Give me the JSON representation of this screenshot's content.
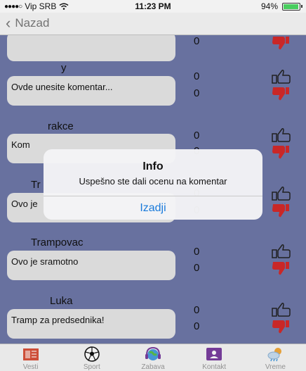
{
  "status": {
    "carrier": "Vip SRB",
    "time": "11:23 PM",
    "battery": "94%",
    "battery_level": 0.94
  },
  "nav": {
    "back_label": "Nazad"
  },
  "comments": [
    {
      "author": "",
      "text": "",
      "likes": "",
      "dislikes": "0"
    },
    {
      "author": "y",
      "text": "Ovde unesite komentar...",
      "likes": "0",
      "dislikes": "0"
    },
    {
      "author": "rakce",
      "text": "Kom",
      "likes": "0",
      "dislikes": "0"
    },
    {
      "author": "Tr",
      "text": "Ovo je",
      "likes": "0",
      "dislikes": "0"
    },
    {
      "author": "Trampovac",
      "text": "Ovo je sramotno",
      "likes": "0",
      "dislikes": "0"
    },
    {
      "author": "Luka",
      "text": "Tramp za predsednika!",
      "likes": "0",
      "dislikes": "0"
    }
  ],
  "alert": {
    "title": "Info",
    "message": "Uspešno ste dali ocenu na komentar",
    "button": "Izadji"
  },
  "tabs": [
    {
      "label": "Vesti",
      "icon": "newspaper-icon"
    },
    {
      "label": "Sport",
      "icon": "soccer-ball-icon"
    },
    {
      "label": "Zabava",
      "icon": "globe-headphones-icon"
    },
    {
      "label": "Kontakt",
      "icon": "contact-card-icon"
    },
    {
      "label": "Vreme",
      "icon": "weather-icon"
    }
  ],
  "colors": {
    "content_bg": "#6e78a8",
    "like": "#333333",
    "dislike": "#d42a2a",
    "accent": "#1a7bdb"
  }
}
